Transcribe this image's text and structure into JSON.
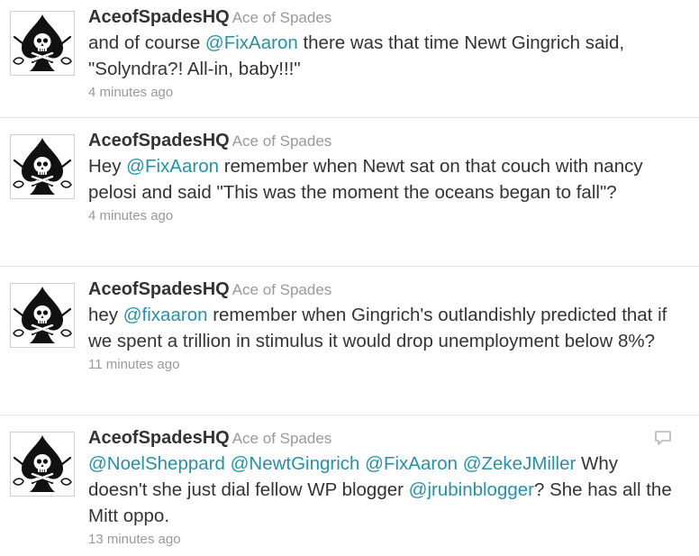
{
  "tweets": [
    {
      "screen_name": "AceofSpadesHQ",
      "full_name": "Ace of Spades",
      "parts": [
        {
          "t": "text",
          "v": "and of course "
        },
        {
          "t": "mention",
          "v": "@FixAaron"
        },
        {
          "t": "text",
          "v": " there was that time Newt Gingrich said, \"Solyndra?! All-in, baby!!!\""
        }
      ],
      "time": "4 minutes ago",
      "avatar_icon": "ace-of-spades-skull-icon"
    },
    {
      "screen_name": "AceofSpadesHQ",
      "full_name": "Ace of Spades",
      "parts": [
        {
          "t": "text",
          "v": "Hey "
        },
        {
          "t": "mention",
          "v": "@FixAaron"
        },
        {
          "t": "text",
          "v": " remember when Newt sat on that couch with nancy pelosi and said \"This was the moment the oceans began to fall\"?"
        }
      ],
      "time": "4 minutes ago",
      "avatar_icon": "ace-of-spades-skull-icon"
    },
    {
      "screen_name": "AceofSpadesHQ",
      "full_name": "Ace of Spades",
      "parts": [
        {
          "t": "text",
          "v": "hey "
        },
        {
          "t": "mention",
          "v": "@fixaaron"
        },
        {
          "t": "text",
          "v": " remember when Gingrich's outlandishly predicted that if we spent a trillion in stimulus it would drop unemployment below 8%?"
        }
      ],
      "time": "11 minutes ago",
      "avatar_icon": "ace-of-spades-skull-icon"
    },
    {
      "screen_name": "AceofSpadesHQ",
      "full_name": "Ace of Spades",
      "parts": [
        {
          "t": "mention",
          "v": "@NoelSheppard"
        },
        {
          "t": "text",
          "v": " "
        },
        {
          "t": "mention",
          "v": "@NewtGingrich"
        },
        {
          "t": "text",
          "v": " "
        },
        {
          "t": "mention",
          "v": "@FixAaron"
        },
        {
          "t": "text",
          "v": " "
        },
        {
          "t": "mention",
          "v": "@ZekeJMiller"
        },
        {
          "t": "text",
          "v": " Why doesn't she just dial fellow WP blogger "
        },
        {
          "t": "mention",
          "v": "@jrubinblogger"
        },
        {
          "t": "text",
          "v": "? She has all the Mitt oppo."
        }
      ],
      "time": "13 minutes ago",
      "avatar_icon": "ace-of-spades-skull-icon",
      "has_reply_icon": true
    }
  ],
  "colors": {
    "mention": "#2a8fa4",
    "meta": "#999999",
    "text": "#333333",
    "divider": "#e6e6e6"
  }
}
